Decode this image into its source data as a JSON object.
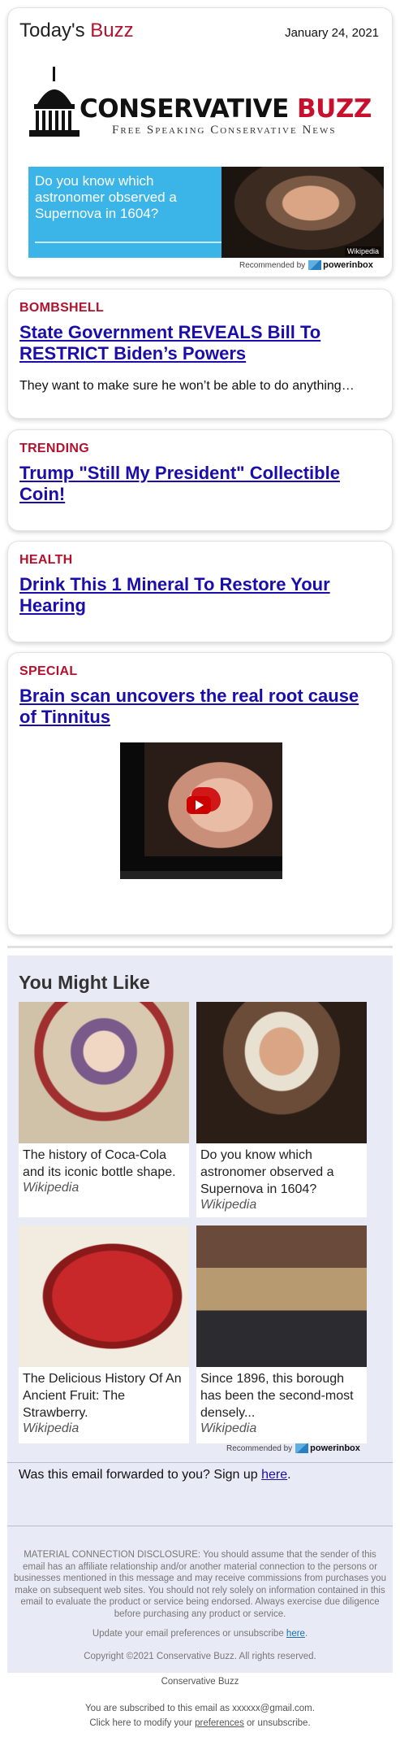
{
  "header": {
    "brand_prefix": "Today's ",
    "brand_accent": "Buzz",
    "date": "January 24, 2021"
  },
  "logo": {
    "word_main": "CONSERVATIVE ",
    "word_accent": "BUZZ",
    "tagline": "Free Speaking Conservative News"
  },
  "top_ad": {
    "text": "Do you know which astronomer observed a Supernova in 1604?",
    "source": "Wikipedia",
    "recommended_by": "Recommended by",
    "brand": "powerinbox"
  },
  "stories": [
    {
      "category": "BOMBSHELL",
      "headline": "State Government REVEALS Bill To RESTRICT Biden’s Powers",
      "blurb": "They want to make sure he won’t be able to do anything…"
    },
    {
      "category": "TRENDING",
      "headline": "Trump \"Still My President\" Collectible Coin!"
    },
    {
      "category": "HEALTH",
      "headline": "Drink This 1 Mineral To Restore Your Hearing"
    },
    {
      "category": "SPECIAL",
      "headline": "Brain scan uncovers the real root cause of Tinnitus"
    }
  ],
  "you_might_like": {
    "title": "You Might Like",
    "tiles": [
      {
        "title": "The history of Coca-Cola and its iconic bottle shape.",
        "source": "Wikipedia"
      },
      {
        "title": "Do you know which astronomer observed a Supernova in 1604?",
        "source": "Wikipedia"
      },
      {
        "title": "The Delicious History Of An Ancient Fruit: The Strawberry.",
        "source": "Wikipedia"
      },
      {
        "title": "Since 1896, this borough has been the second-most densely...",
        "source": "Wikipedia"
      }
    ],
    "recommended_by": "Recommended by",
    "brand": "powerinbox"
  },
  "forward": {
    "text": "Was this email forwarded to you? Sign up ",
    "link": "here",
    "end": "."
  },
  "disclosure": "MATERIAL CONNECTION DISCLOSURE: You should assume that the sender of this email has an affiliate relationship and/or another material connection to the persons or businesses mentioned in this message and may receive commissions from purchases you make on subsequent web sites. You should not rely solely on information contained in this email to evaluate the product or service being endorsed. Always exercise due diligence before purchasing any product or service.",
  "update_prefs": {
    "text": "Update your email preferences or unsubscribe ",
    "link": "here",
    "end": "."
  },
  "copyright": "Copyright ©2021 Conservative Buzz. All rights reserved.",
  "footer": {
    "company": "Conservative Buzz",
    "subscribed": "You are subscribed to this email as xxxxxx@gmail.com.",
    "modify_prefix": "Click here to modify your ",
    "modify_link": "preferences",
    "modify_suffix": " or unsubscribe."
  },
  "colors": {
    "accent": "#b3122e",
    "link": "#1a0dab",
    "ad_blue": "#3bb5e8",
    "panel": "#e8ebf6"
  }
}
